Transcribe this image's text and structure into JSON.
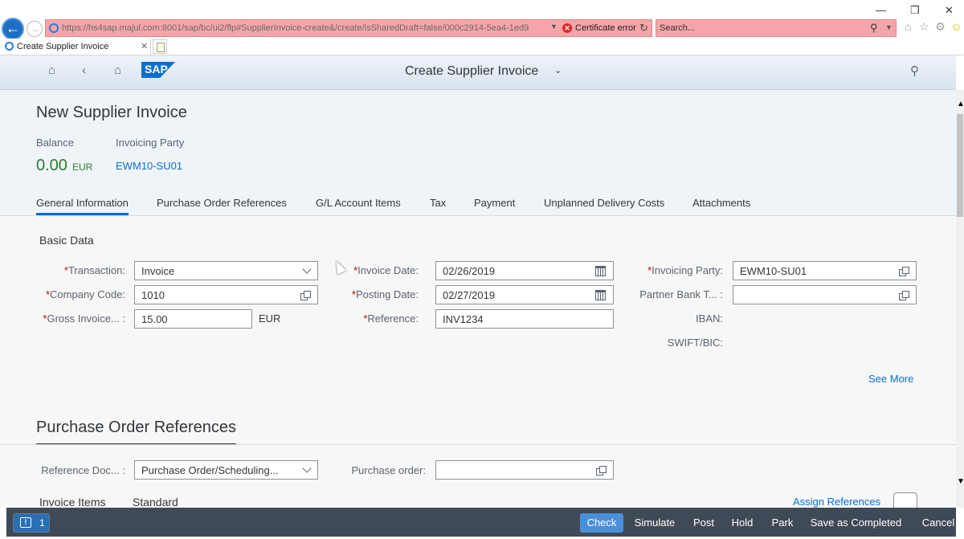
{
  "browser": {
    "url": "https://hs4sap.majul.com:8001/sap/bc/ui2/flp#SupplierInvoice-create&/create/isSharedDraft=false/000c2914-5ea4-1ed9",
    "cert_error": "Certificate error",
    "search_placeholder": "Search...",
    "tab_title": "Create Supplier Invoice"
  },
  "shell": {
    "title": "Create Supplier Invoice"
  },
  "header": {
    "title": "New Supplier Invoice",
    "balance_label": "Balance",
    "balance_value": "0.00",
    "balance_currency": "EUR",
    "invoicing_party_label": "Invoicing Party",
    "invoicing_party_value": "EWM10-SU01"
  },
  "anchors": [
    "General Information",
    "Purchase Order References",
    "G/L Account Items",
    "Tax",
    "Payment",
    "Unplanned Delivery Costs",
    "Attachments"
  ],
  "basic_data": {
    "title": "Basic Data",
    "transaction": {
      "label": "Transaction:",
      "value": "Invoice"
    },
    "company_code": {
      "label": "Company Code:",
      "value": "1010"
    },
    "gross_invoice": {
      "label": "Gross Invoice... :",
      "value": "15.00",
      "currency": "EUR"
    },
    "invoice_date": {
      "label": "Invoice Date:",
      "value": "02/26/2019"
    },
    "posting_date": {
      "label": "Posting Date:",
      "value": "02/27/2019"
    },
    "reference": {
      "label": "Reference:",
      "value": "INV1234"
    },
    "invoicing_party": {
      "label": "Invoicing Party:",
      "value": "EWM10-SU01"
    },
    "partner_bank": {
      "label": "Partner Bank T... :",
      "value": ""
    },
    "iban": {
      "label": "IBAN:"
    },
    "swift": {
      "label": "SWIFT/BIC:"
    },
    "see_more": "See More"
  },
  "po_refs": {
    "title": "Purchase Order References",
    "reference_doc": {
      "label": "Reference Doc... :",
      "value": "Purchase Order/Scheduling..."
    },
    "purchase_order": {
      "label": "Purchase order:",
      "value": ""
    },
    "invoice_items": "Invoice Items",
    "standard": "Standard",
    "assign_references": "Assign References"
  },
  "footer": {
    "message_count": "1",
    "buttons": [
      "Check",
      "Simulate",
      "Post",
      "Hold",
      "Park",
      "Save as Completed",
      "Cancel"
    ]
  }
}
